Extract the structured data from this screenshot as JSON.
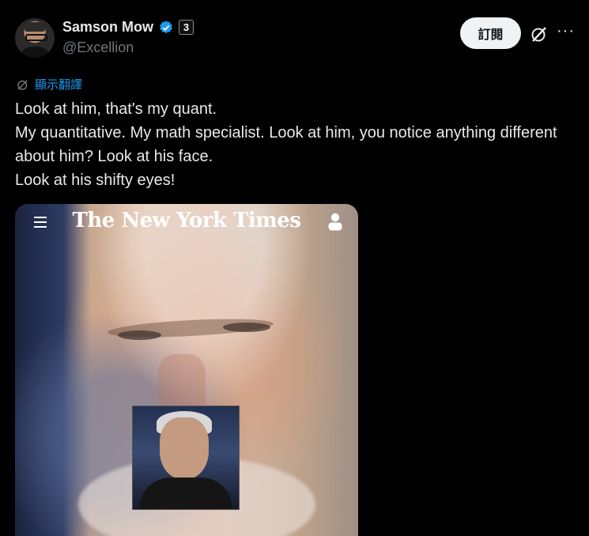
{
  "author": {
    "name": "Samson Mow",
    "handle": "@Excellion",
    "badge": "3"
  },
  "actions": {
    "subscribe_label": "訂閱",
    "more_label": "···"
  },
  "translate": {
    "label": "顯示翻譯"
  },
  "tweet": {
    "lines": [
      "Look at him, that's my quant.",
      "My quantitative. My math specialist. Look at him, you notice anything different about him? Look at his face.",
      "Look at his shifty eyes!"
    ]
  },
  "media": {
    "masthead": "The New York Times"
  },
  "colors": {
    "accent": "#1d9bf0",
    "background": "#000000",
    "text": "#e7e9ea",
    "muted": "#71767b"
  },
  "icons": [
    "verified-icon",
    "grok-icon",
    "more-icon",
    "translate-icon",
    "menu-icon",
    "user-icon"
  ]
}
